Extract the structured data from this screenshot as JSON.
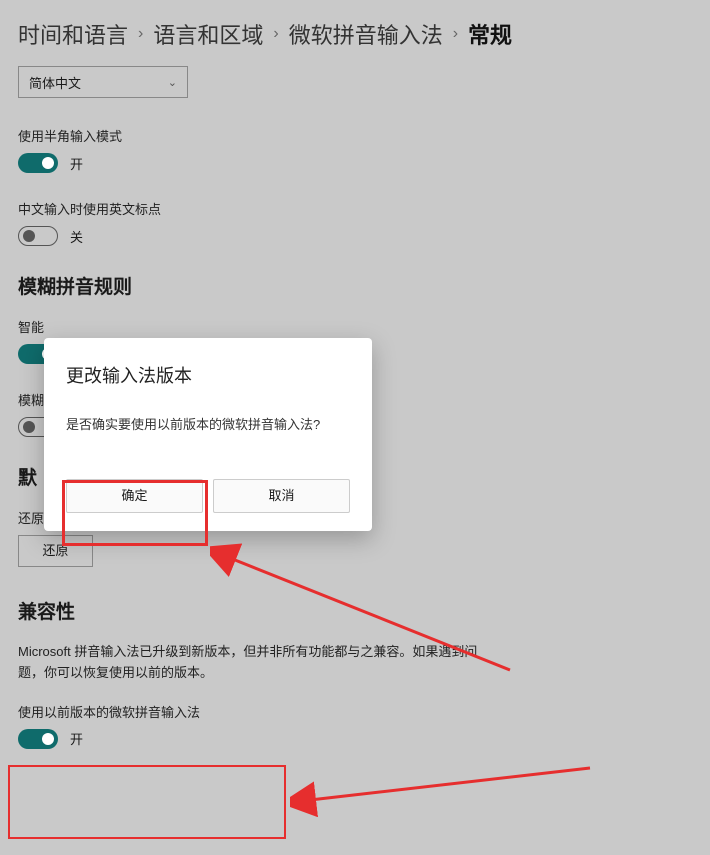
{
  "breadcrumb": {
    "items": [
      "时间和语言",
      "语言和区域",
      "微软拼音输入法"
    ],
    "current": "常规"
  },
  "dropdown": {
    "selected": "简体中文"
  },
  "halfwidth": {
    "label": "使用半角输入模式",
    "state": "开"
  },
  "englishPunct": {
    "label": "中文输入时使用英文标点",
    "state": "关"
  },
  "fuzzy": {
    "heading": "模糊拼音规则",
    "smart_prefix": "智能",
    "fuzzy_prefix": "模糊"
  },
  "defaults": {
    "heading_prefix": "默",
    "restore_label": "还原输入法默认设置",
    "restore_btn": "还原"
  },
  "compat": {
    "heading": "兼容性",
    "desc": "Microsoft 拼音输入法已升级到新版本，但并非所有功能都与之兼容。如果遇到问题，你可以恢复使用以前的版本。",
    "toggle_label": "使用以前版本的微软拼音输入法",
    "toggle_state": "开"
  },
  "modal": {
    "title": "更改输入法版本",
    "message": "是否确实要使用以前版本的微软拼音输入法?",
    "ok": "确定",
    "cancel": "取消"
  }
}
